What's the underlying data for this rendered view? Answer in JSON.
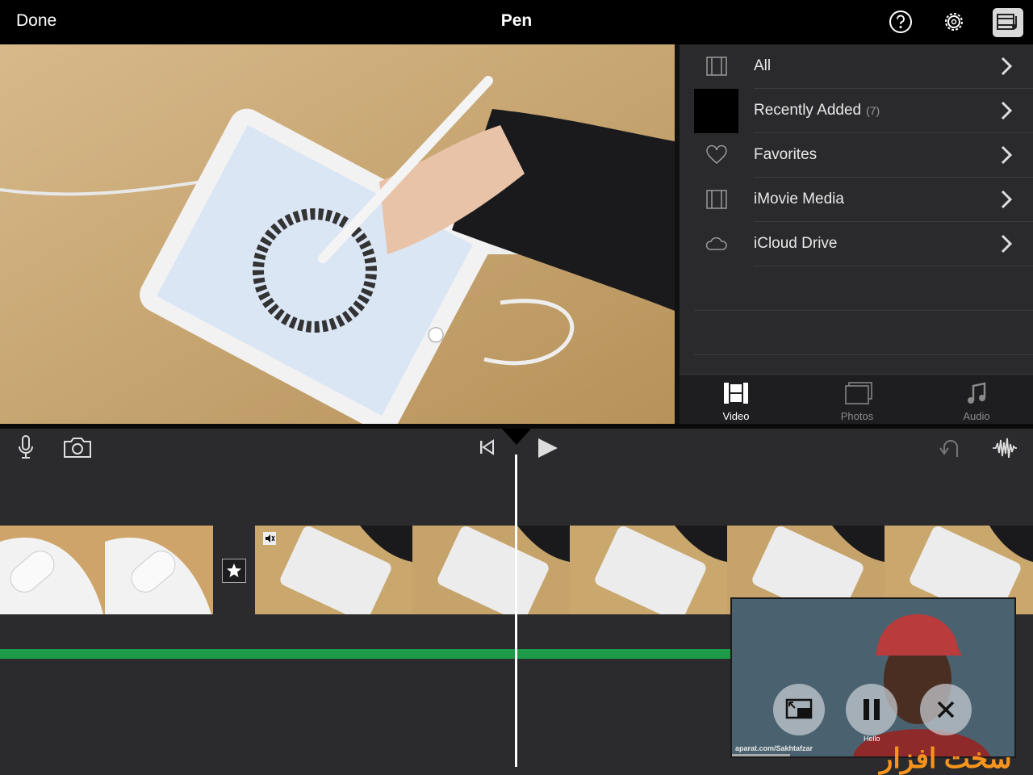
{
  "topbar": {
    "done_label": "Done",
    "title": "Pen",
    "icons": [
      "help-icon",
      "settings-gear-icon",
      "media-browser-icon"
    ]
  },
  "browser": {
    "items": [
      {
        "label": "All",
        "count": "",
        "icon": "film-strip-icon"
      },
      {
        "label": "Recently Added",
        "count": "(7)",
        "icon": "thumbnail"
      },
      {
        "label": "Favorites",
        "count": "",
        "icon": "heart-icon"
      },
      {
        "label": "iMovie Media",
        "count": "",
        "icon": "film-strip-icon"
      },
      {
        "label": "iCloud Drive",
        "count": "",
        "icon": "cloud-icon"
      }
    ],
    "tabs": [
      {
        "label": "Video",
        "active": true
      },
      {
        "label": "Photos",
        "active": false
      },
      {
        "label": "Audio",
        "active": false
      }
    ]
  },
  "pip": {
    "caption": "Hello",
    "source": "aparat.com/Sakhtafzar",
    "buttons": [
      "exit-pip-icon",
      "pause-icon",
      "close-icon"
    ]
  },
  "watermark": "سخت افزار",
  "colors": {
    "audio_track": "#1e9b48",
    "browser_bg": "#2a2a2c",
    "timeline_bg": "#2b2b2d"
  }
}
